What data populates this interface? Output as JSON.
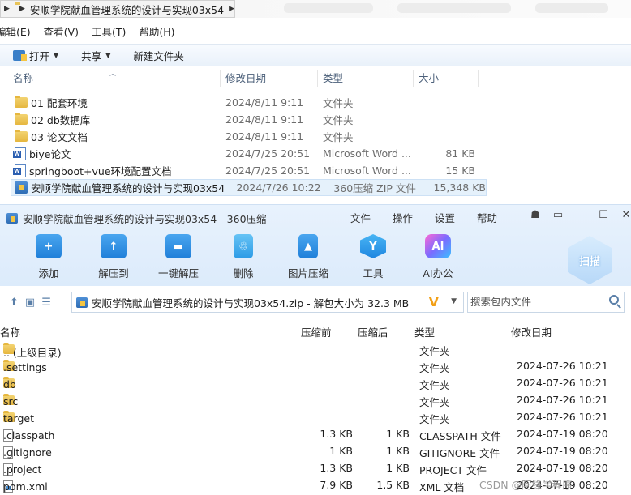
{
  "explorer": {
    "address": "安顺学院献血管理系统的设计与实现03x54",
    "menu": [
      "编辑(E)",
      "查看(V)",
      "工具(T)",
      "帮助(H)"
    ],
    "toolbar": {
      "open": "打开",
      "share": "共享",
      "new_folder": "新建文件夹"
    },
    "columns": {
      "name": "名称",
      "date": "修改日期",
      "type": "类型",
      "size": "大小"
    },
    "files": [
      {
        "name": "01 配套环境",
        "date": "2024/8/11 9:11",
        "type": "文件夹",
        "size": "",
        "icon": "folder-icon"
      },
      {
        "name": "02 db数据库",
        "date": "2024/8/11 9:11",
        "type": "文件夹",
        "size": "",
        "icon": "folder-icon"
      },
      {
        "name": "03 论文文档",
        "date": "2024/8/11 9:11",
        "type": "文件夹",
        "size": "",
        "icon": "folder-icon"
      },
      {
        "name": "biye论文",
        "date": "2024/7/25 20:51",
        "type": "Microsoft Word ...",
        "size": "81 KB",
        "icon": "word-doc-icon"
      },
      {
        "name": "springboot+vue环境配置文档",
        "date": "2024/7/25 20:51",
        "type": "Microsoft Word ...",
        "size": "15 KB",
        "icon": "word-doc-icon"
      },
      {
        "name": "安顺学院献血管理系统的设计与实现03x54",
        "date": "2024/7/26 10:22",
        "type": "360压缩 ZIP 文件",
        "size": "15,348 KB",
        "icon": "zip-icon"
      }
    ]
  },
  "zip": {
    "title": "安顺学院献血管理系统的设计与实现03x54 - 360压缩",
    "menu": [
      "文件",
      "操作",
      "设置",
      "帮助"
    ],
    "window_buttons": [
      "☗",
      "▭",
      "—",
      "☐",
      "✕"
    ],
    "tools": [
      {
        "label": "添加",
        "icon": "add-icon"
      },
      {
        "label": "解压到",
        "icon": "extract-to-icon"
      },
      {
        "label": "一键解压",
        "icon": "one-click-extract-icon"
      },
      {
        "label": "删除",
        "icon": "delete-icon"
      },
      {
        "label": "图片压缩",
        "icon": "image-compress-icon"
      },
      {
        "label": "工具",
        "icon": "tools-icon"
      },
      {
        "label": "AI办公",
        "icon": "ai-office-icon"
      }
    ],
    "scan_label": "扫描",
    "path": "安顺学院献血管理系统的设计与实现03x54.zip - 解包大小为 32.3 MB",
    "search_placeholder": "搜索包内文件",
    "columns": {
      "name": "名称",
      "compressed": "压缩前",
      "uncompressed": "压缩后",
      "type": "类型",
      "date": "修改日期"
    },
    "rows": [
      {
        "name": ".. (上级目录)",
        "before": "",
        "after": "",
        "type": "文件夹",
        "date": "",
        "icon": "folder-icon"
      },
      {
        "name": ".settings",
        "before": "",
        "after": "",
        "type": "文件夹",
        "date": "2024-07-26 10:21",
        "icon": "folder-icon"
      },
      {
        "name": "db",
        "before": "",
        "after": "",
        "type": "文件夹",
        "date": "2024-07-26 10:21",
        "icon": "folder-icon"
      },
      {
        "name": "src",
        "before": "",
        "after": "",
        "type": "文件夹",
        "date": "2024-07-26 10:21",
        "icon": "folder-icon"
      },
      {
        "name": "target",
        "before": "",
        "after": "",
        "type": "文件夹",
        "date": "2024-07-26 10:21",
        "icon": "folder-icon"
      },
      {
        "name": ".classpath",
        "before": "1.3 KB",
        "after": "1 KB",
        "type": "CLASSPATH 文件",
        "date": "2024-07-19 08:20",
        "icon": "file-icon"
      },
      {
        "name": ".gitignore",
        "before": "1 KB",
        "after": "1 KB",
        "type": "GITIGNORE 文件",
        "date": "2024-07-19 08:20",
        "icon": "file-icon"
      },
      {
        "name": ".project",
        "before": "1.3 KB",
        "after": "1 KB",
        "type": "PROJECT 文件",
        "date": "2024-07-19 08:20",
        "icon": "file-icon"
      },
      {
        "name": "pom.xml",
        "before": "7.9 KB",
        "after": "1.5 KB",
        "type": "XML 文档",
        "date": "2024-07-19 08:20",
        "icon": "xml-file-icon"
      }
    ]
  },
  "watermark": "CSDN @阿锋学程序"
}
